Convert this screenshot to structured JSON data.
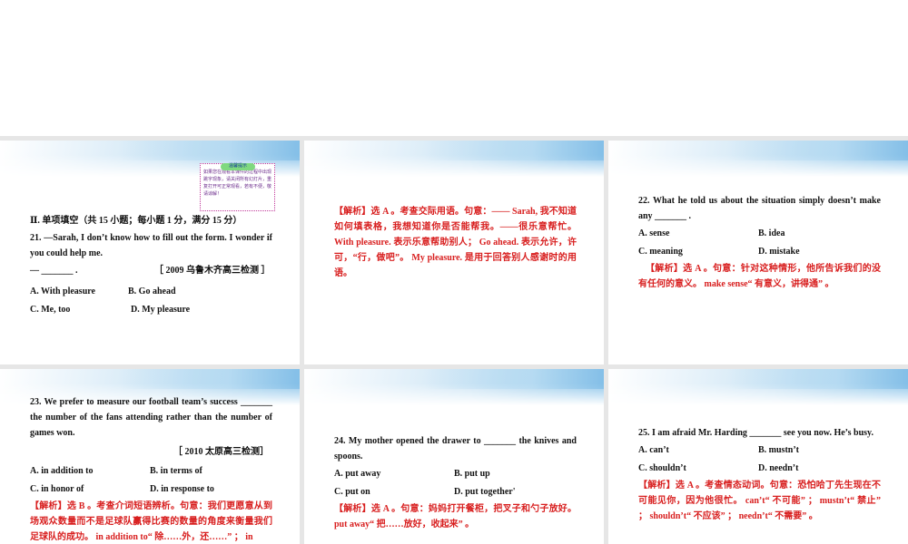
{
  "slides": [
    {
      "notice": {
        "title": "温馨提示",
        "text": "如果您在观看本课件的过程中出现跳字现象，请关闭所有幻灯片，重复打开可正常观看，若有不便，敬请谅解！"
      },
      "section": "Ⅱ. 单项填空（共 15 小题；每小题 1 分，满分 15 分）",
      "question": "21. —Sarah, I don’t know how to fill out the form. I wonder if you could help me.",
      "blank": "— _______ .",
      "source": "［ 2009 乌鲁木齐高三检测 ］",
      "options": [
        "A. With pleasure",
        "B. Go ahead",
        "C. Me, too",
        "D. My pleasure"
      ]
    },
    {
      "analysis": "【解析】选 A 。考查交际用语。句意：—— Sarah, 我不知道如何填表格，我想知道你是否能帮我。——很乐意帮忙。 With pleasure. 表示乐意帮助别人； Go ahead. 表示允许，许可，“行，做吧”。 My pleasure. 是用于回答别人感谢时的用语。"
    },
    {
      "question": "22. What he told us about the situation simply doesn’t make any _______ .",
      "options": [
        "A. sense",
        "B. idea",
        "C. meaning",
        "D. mistake"
      ],
      "analysis": "【解析】选 A 。句意：针对这种情形，他所告诉我们的没有任何的意义。 make sense“ 有意义，讲得通” 。"
    },
    {
      "question": "23. We prefer to measure our football team’s success _______ the number of the fans attending rather than the number of games won.",
      "source": "［ 2010 太原高三检测］",
      "options": [
        "A. in addition to",
        "B. in terms of",
        "C. in honor of",
        "D. in response to"
      ],
      "analysis": "【解析】选 B 。考查介词短语辨析。句意：我们更愿意从到场观众数量而不是足球队赢得比赛的数量的角度来衡量我们足球队的成功。 in addition to“ 除……外，还……” ； in"
    },
    {
      "question": "24. My mother opened the drawer to _______ the knives and spoons.",
      "options": [
        "A. put away",
        "B. put up",
        "C. put on",
        "D. put together'"
      ],
      "analysis": "【解析】选 A 。句意：妈妈打开餐柜，把叉子和勺子放好。 put away“ 把……放好，收起来” 。"
    },
    {
      "question": "25. I am afraid Mr. Harding _______ see you now. He’s busy.",
      "options": [
        "A. can’t",
        "B. mustn’t",
        "C. shouldn’t",
        "D. needn’t"
      ],
      "analysis": "【解析】选 A 。考查情态动词。句意：恐怕哈丁先生现在不可能见你，因为他很忙。 can’t“ 不可能” ； mustn’t“ 禁止” ； shouldn’t“ 不应该” ； needn’t“ 不需要” 。"
    }
  ]
}
